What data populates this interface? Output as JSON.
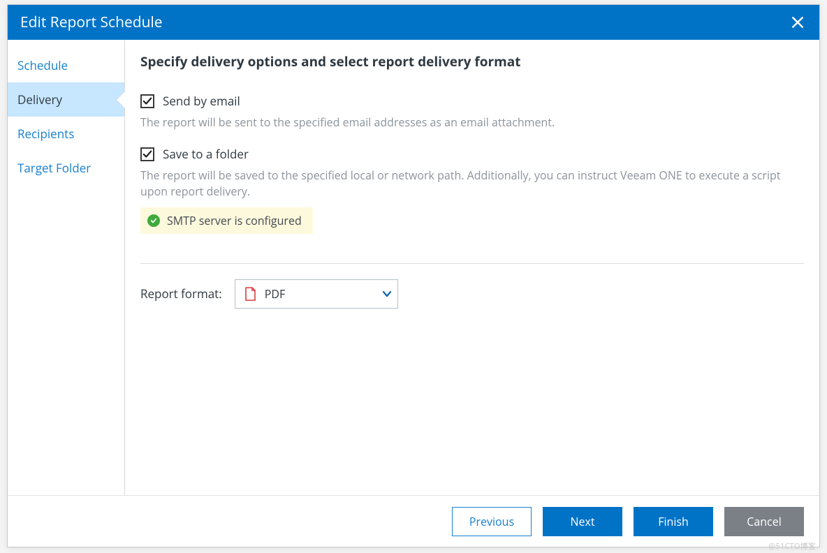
{
  "dialog": {
    "title": "Edit Report Schedule"
  },
  "sidebar": {
    "items": [
      {
        "label": "Schedule"
      },
      {
        "label": "Delivery"
      },
      {
        "label": "Recipients"
      },
      {
        "label": "Target Folder"
      }
    ],
    "active_index": 1
  },
  "main": {
    "heading": "Specify delivery options and select report delivery format",
    "options": [
      {
        "label": "Send by email",
        "checked": true,
        "description": "The report will be sent to the specified email addresses as an email attachment."
      },
      {
        "label": "Save to a folder",
        "checked": true,
        "description": "The report will be saved to the specified local or network path. Additionally, you can instruct Veeam ONE to execute a script upon report delivery."
      }
    ],
    "status": {
      "text": "SMTP server is configured",
      "state": "ok"
    },
    "report_format": {
      "label": "Report format:",
      "selected": "PDF"
    }
  },
  "footer": {
    "previous": "Previous",
    "next": "Next",
    "finish": "Finish",
    "cancel": "Cancel"
  },
  "watermark": "@51CTO博客"
}
